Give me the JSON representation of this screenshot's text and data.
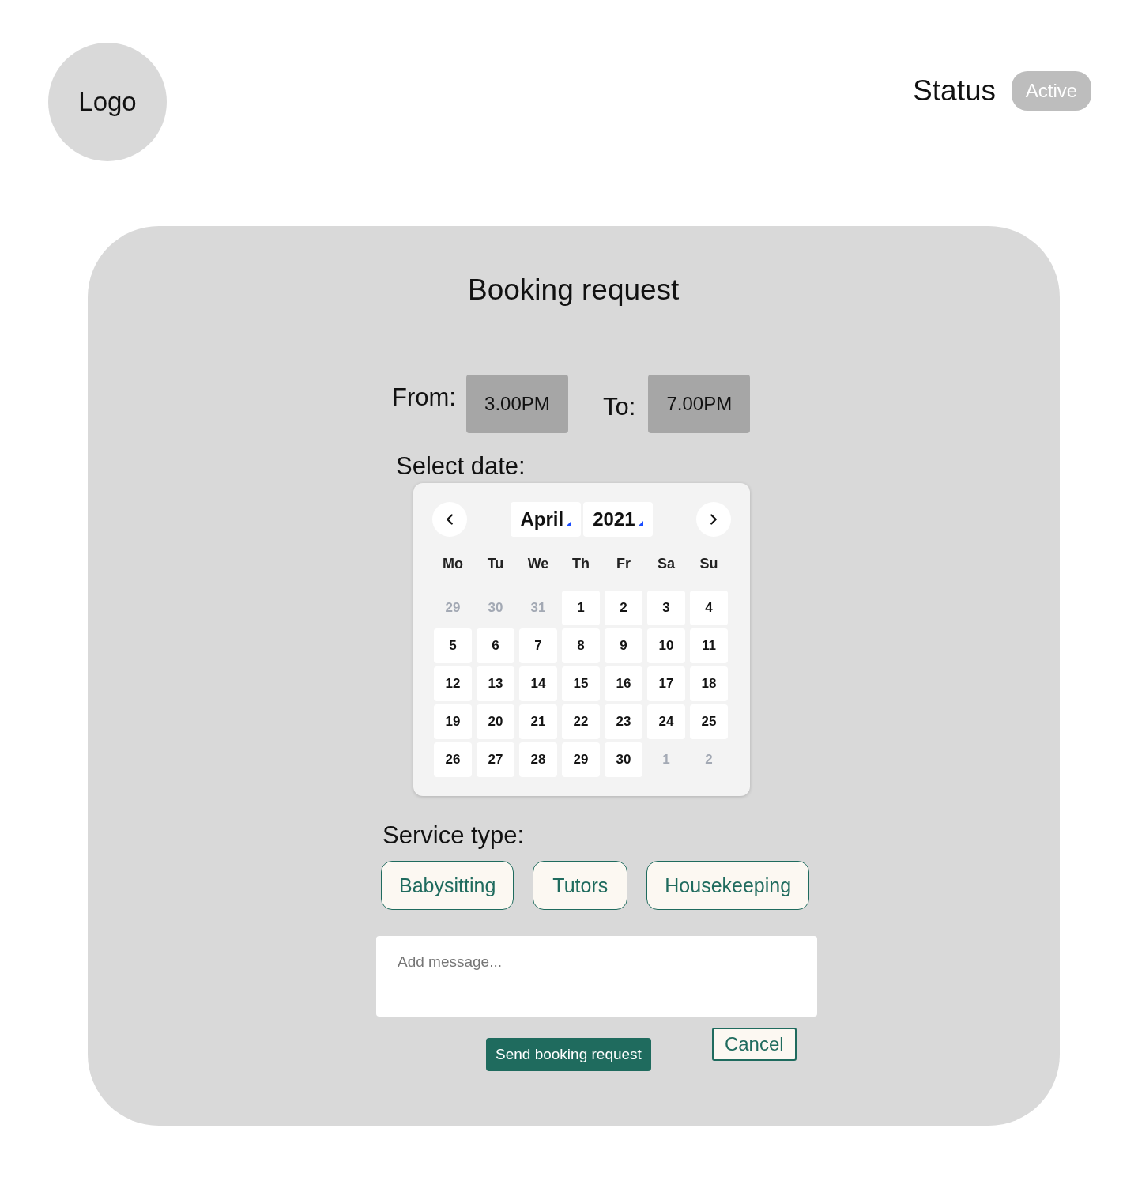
{
  "header": {
    "logo": "Logo",
    "status_label": "Status",
    "status_badge": "Active"
  },
  "booking": {
    "title": "Booking request",
    "times": [
      {
        "label": "From:",
        "value": "3.00PM"
      },
      {
        "label": "To:",
        "value": "7.00PM"
      }
    ],
    "date_label": "Select date:",
    "calendar": {
      "month": "April",
      "year": "2021",
      "weekdays": [
        "Mo",
        "Tu",
        "We",
        "Th",
        "Fr",
        "Sa",
        "Su"
      ],
      "days": [
        {
          "label": "29",
          "muted": true
        },
        {
          "label": "30",
          "muted": true
        },
        {
          "label": "31",
          "muted": true
        },
        {
          "label": "1",
          "muted": false
        },
        {
          "label": "2",
          "muted": false
        },
        {
          "label": "3",
          "muted": false
        },
        {
          "label": "4",
          "muted": false
        },
        {
          "label": "5",
          "muted": false
        },
        {
          "label": "6",
          "muted": false
        },
        {
          "label": "7",
          "muted": false
        },
        {
          "label": "8",
          "muted": false
        },
        {
          "label": "9",
          "muted": false
        },
        {
          "label": "10",
          "muted": false
        },
        {
          "label": "11",
          "muted": false
        },
        {
          "label": "12",
          "muted": false
        },
        {
          "label": "13",
          "muted": false
        },
        {
          "label": "14",
          "muted": false
        },
        {
          "label": "15",
          "muted": false
        },
        {
          "label": "16",
          "muted": false
        },
        {
          "label": "17",
          "muted": false
        },
        {
          "label": "18",
          "muted": false
        },
        {
          "label": "19",
          "muted": false
        },
        {
          "label": "20",
          "muted": false
        },
        {
          "label": "21",
          "muted": false
        },
        {
          "label": "22",
          "muted": false
        },
        {
          "label": "23",
          "muted": false
        },
        {
          "label": "24",
          "muted": false
        },
        {
          "label": "25",
          "muted": false
        },
        {
          "label": "26",
          "muted": false
        },
        {
          "label": "27",
          "muted": false
        },
        {
          "label": "28",
          "muted": false
        },
        {
          "label": "29",
          "muted": false
        },
        {
          "label": "30",
          "muted": false
        },
        {
          "label": "1",
          "muted": true
        },
        {
          "label": "2",
          "muted": true
        }
      ]
    },
    "service_label": "Service type:",
    "services": [
      "Babysitting",
      "Tutors",
      "Housekeeping"
    ],
    "message": {
      "placeholder": "Add message..."
    },
    "buttons": [
      {
        "label": "Send booking request",
        "kind": "primary"
      },
      {
        "label": "Cancel",
        "kind": "secondary"
      }
    ]
  }
}
